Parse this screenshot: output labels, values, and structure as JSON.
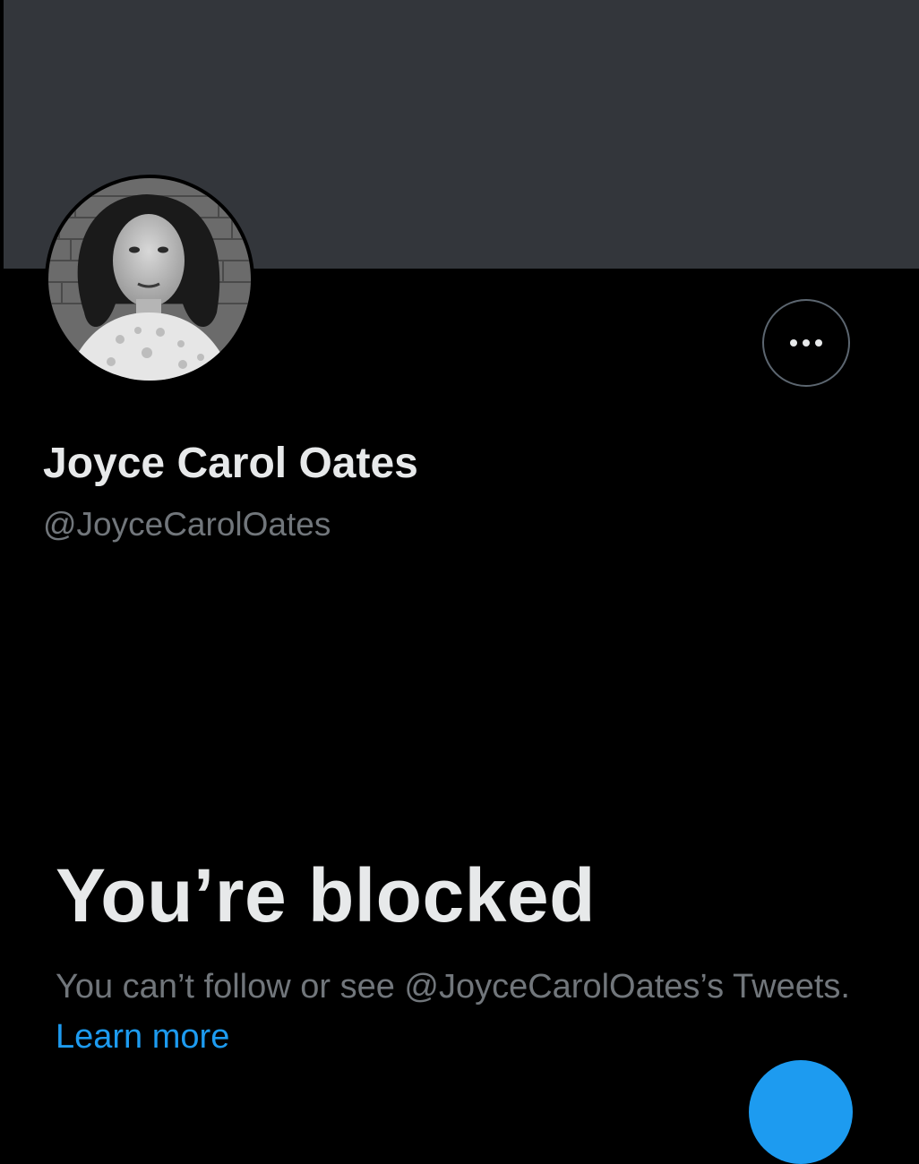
{
  "profile": {
    "display_name": "Joyce Carol Oates",
    "handle": "@JoyceCarolOates",
    "more_button_icon": "more-horizontal-icon",
    "avatar_alt": "profile photo"
  },
  "blocked": {
    "title": "You’re blocked",
    "description_prefix": "You can’t follow or see @JoyceCarolOates’s Tweets. ",
    "learn_more": "Learn more"
  },
  "colors": {
    "background": "#000000",
    "banner": "#33363b",
    "primary_text": "#e7e9ea",
    "secondary_text": "#71767b",
    "accent": "#1d9bf0",
    "button_border": "#5c6670"
  },
  "fab": {
    "icon": "compose-icon"
  }
}
